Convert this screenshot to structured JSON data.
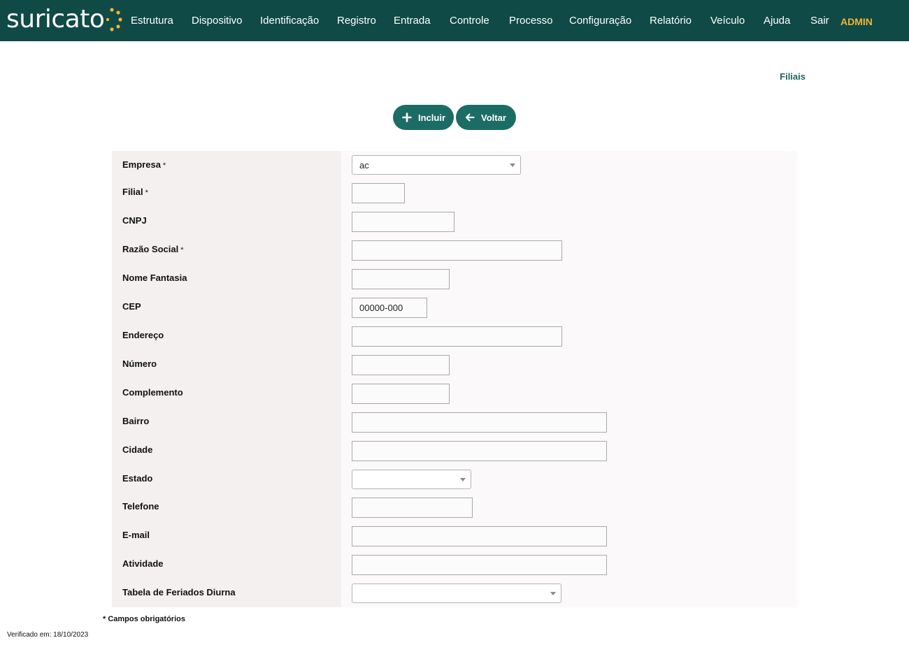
{
  "brand": {
    "logo_text": "suricato",
    "accent_dot_color": "#f2b531",
    "header_bg": "#0f4a46"
  },
  "nav": {
    "items": [
      "Estrutura",
      "Dispositivo",
      "Identificação",
      "Registro",
      "Entrada",
      "Controle",
      "Processo",
      "Configuração",
      "Relatório",
      "Veículo",
      "Ajuda",
      "Sair"
    ],
    "user": "ADMIN"
  },
  "page": {
    "title": "Filiais"
  },
  "actions": {
    "incluir_label": "Incluir",
    "voltar_label": "Voltar",
    "button_color": "#1c6c66"
  },
  "form": {
    "required_marker": "*",
    "fields": [
      {
        "label": "Empresa",
        "required": true,
        "type": "select",
        "value": "ac"
      },
      {
        "label": "Filial",
        "required": true,
        "type": "text",
        "value": ""
      },
      {
        "label": "CNPJ",
        "required": false,
        "type": "text",
        "value": ""
      },
      {
        "label": "Razão Social",
        "required": true,
        "type": "text",
        "value": ""
      },
      {
        "label": "Nome Fantasia",
        "required": false,
        "type": "text",
        "value": ""
      },
      {
        "label": "CEP",
        "required": false,
        "type": "text",
        "value": "00000-000"
      },
      {
        "label": "Endereço",
        "required": false,
        "type": "text",
        "value": ""
      },
      {
        "label": "Número",
        "required": false,
        "type": "text",
        "value": ""
      },
      {
        "label": "Complemento",
        "required": false,
        "type": "text",
        "value": ""
      },
      {
        "label": "Bairro",
        "required": false,
        "type": "text",
        "value": ""
      },
      {
        "label": "Cidade",
        "required": false,
        "type": "text",
        "value": ""
      },
      {
        "label": "Estado",
        "required": false,
        "type": "select",
        "value": ""
      },
      {
        "label": "Telefone",
        "required": false,
        "type": "text",
        "value": ""
      },
      {
        "label": "E-mail",
        "required": false,
        "type": "text",
        "value": ""
      },
      {
        "label": "Atividade",
        "required": false,
        "type": "text",
        "value": ""
      },
      {
        "label": "Tabela de Feriados Diurna",
        "required": false,
        "type": "select",
        "value": ""
      }
    ]
  },
  "footer": {
    "required_note": "* Campos obrigatórios",
    "verified": "Verificado em: 18/10/2023"
  }
}
